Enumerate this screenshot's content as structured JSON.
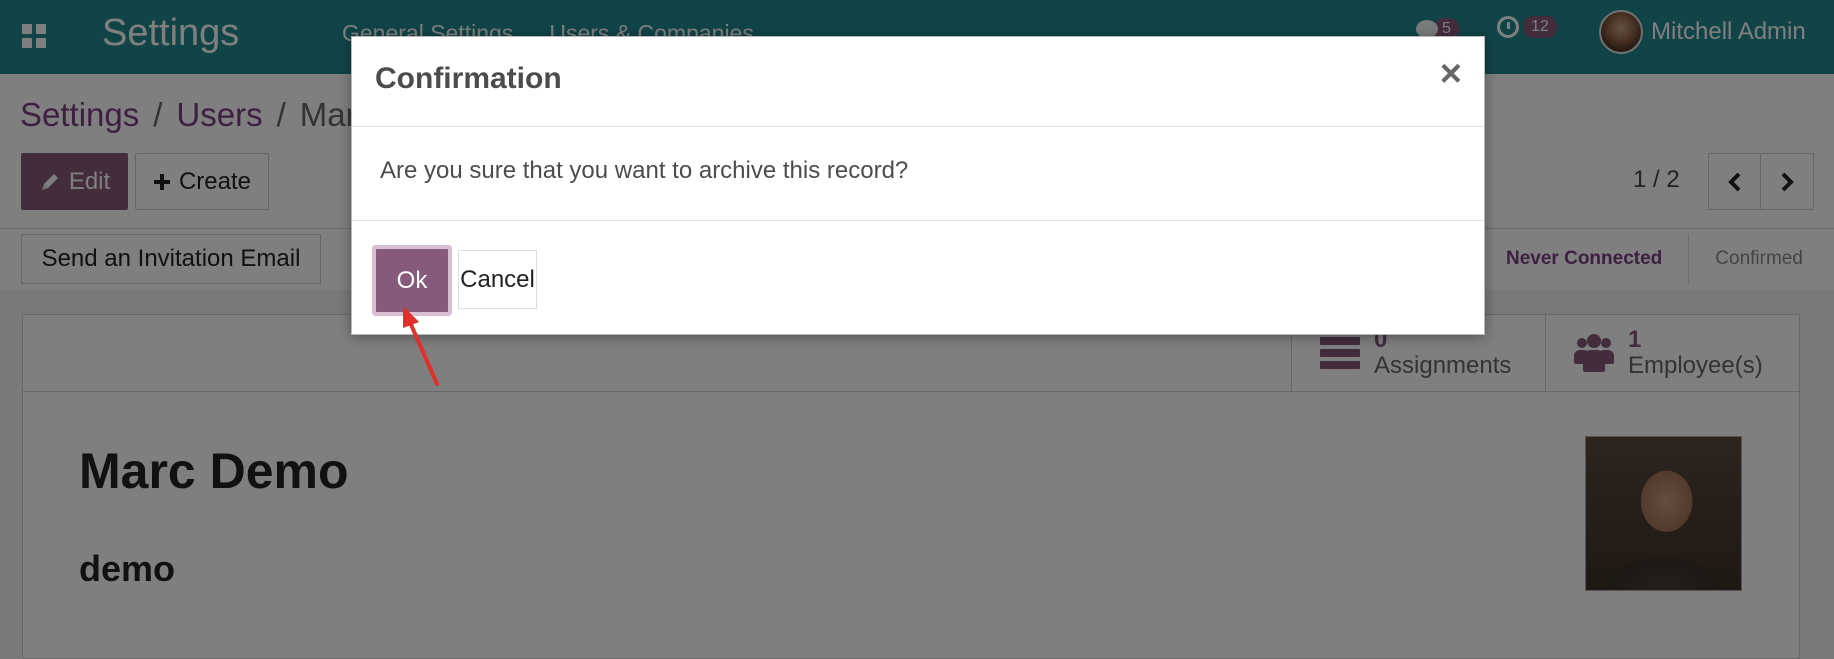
{
  "navbar": {
    "app_title": "Settings",
    "menu": [
      "General Settings",
      "Users & Companies"
    ],
    "messages_badge": "5",
    "activities_badge": "12",
    "user_name": "Mitchell Admin"
  },
  "breadcrumb": {
    "items": [
      "Settings",
      "Users",
      "Marc Demo"
    ],
    "separator": "/"
  },
  "control_panel": {
    "edit_label": "Edit",
    "create_label": "Create",
    "pager": "1 / 2"
  },
  "statusbar": {
    "invite_label": "Send an Invitation Email",
    "stages": [
      "Never Connected",
      "Confirmed"
    ]
  },
  "stat_buttons": [
    {
      "value": "0",
      "label": "Assignments"
    },
    {
      "value": "1",
      "label": "Employee(s)"
    }
  ],
  "record": {
    "name": "Marc Demo",
    "login": "demo"
  },
  "dialog": {
    "title": "Confirmation",
    "message": "Are you sure that you want to archive this record?",
    "ok_label": "Ok",
    "cancel_label": "Cancel",
    "close_glyph": "×"
  },
  "colors": {
    "navbar": "#22888f",
    "primary": "#875a7b",
    "link": "#7c3f84",
    "annotation_arrow": "#e0302a"
  }
}
